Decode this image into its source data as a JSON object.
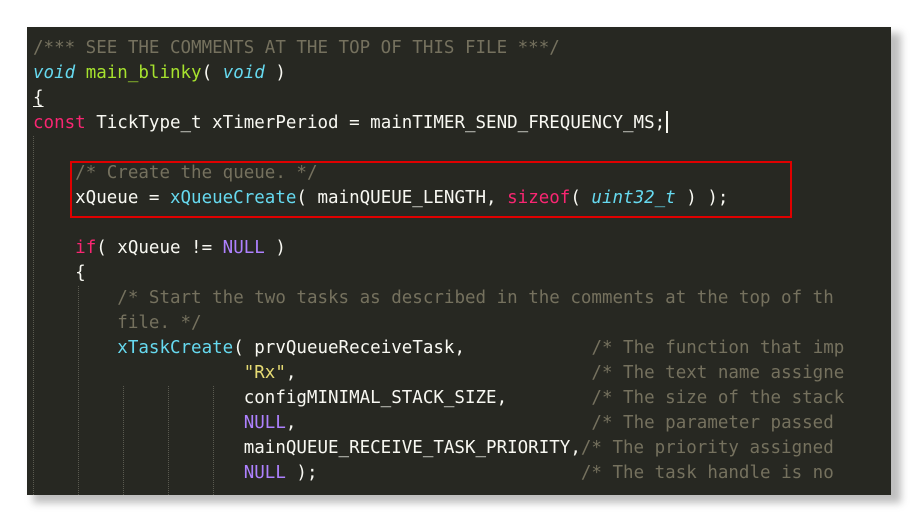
{
  "code_lines": [
    {
      "parts": [
        {
          "cls": "c",
          "text": "/*** SEE THE COMMENTS AT THE TOP OF THIS FILE ***/"
        }
      ]
    },
    {
      "parts": [
        {
          "cls": "t",
          "text": "void"
        },
        {
          "cls": "plain",
          "text": " "
        },
        {
          "cls": "f",
          "text": "main_blinky"
        },
        {
          "cls": "plain",
          "text": "( "
        },
        {
          "cls": "t",
          "text": "void"
        },
        {
          "cls": "plain",
          "text": " )"
        }
      ]
    },
    {
      "parts": [
        {
          "cls": "plain brace-ul",
          "text": "{"
        }
      ]
    },
    {
      "parts": [
        {
          "cls": "k",
          "text": "const"
        },
        {
          "cls": "plain",
          "text": " TickType_t xTimerPeriod = mainTIMER_SEND_FREQUENCY_MS;"
        }
      ],
      "cursor": true
    },
    {
      "parts": [
        {
          "cls": "plain",
          "text": ""
        }
      ]
    },
    {
      "parts": [
        {
          "cls": "plain",
          "text": "    "
        },
        {
          "cls": "c",
          "text": "/* Create the queue. */"
        }
      ]
    },
    {
      "parts": [
        {
          "cls": "plain",
          "text": "    xQueue = "
        },
        {
          "cls": "fc",
          "text": "xQueueCreate"
        },
        {
          "cls": "plain",
          "text": "( mainQUEUE_LENGTH, "
        },
        {
          "cls": "k",
          "text": "sizeof"
        },
        {
          "cls": "plain",
          "text": "( "
        },
        {
          "cls": "t",
          "text": "uint32_t"
        },
        {
          "cls": "plain",
          "text": " ) );"
        }
      ]
    },
    {
      "parts": [
        {
          "cls": "plain",
          "text": ""
        }
      ]
    },
    {
      "parts": [
        {
          "cls": "plain",
          "text": "    "
        },
        {
          "cls": "k",
          "text": "if"
        },
        {
          "cls": "plain",
          "text": "( xQueue != "
        },
        {
          "cls": "cn",
          "text": "NULL"
        },
        {
          "cls": "plain",
          "text": " )"
        }
      ]
    },
    {
      "parts": [
        {
          "cls": "plain",
          "text": "    {"
        }
      ]
    },
    {
      "parts": [
        {
          "cls": "plain",
          "text": "        "
        },
        {
          "cls": "c",
          "text": "/* Start the two tasks as described in the comments at the top of th"
        }
      ]
    },
    {
      "parts": [
        {
          "cls": "plain",
          "text": "        "
        },
        {
          "cls": "c",
          "text": "file. */"
        }
      ]
    },
    {
      "parts": [
        {
          "cls": "plain",
          "text": "        "
        },
        {
          "cls": "fc",
          "text": "xTaskCreate"
        },
        {
          "cls": "plain",
          "text": "( prvQueueReceiveTask,            "
        },
        {
          "cls": "c",
          "text": "/* The function that imp"
        }
      ]
    },
    {
      "parts": [
        {
          "cls": "plain",
          "text": "                    "
        },
        {
          "cls": "s",
          "text": "\"Rx\""
        },
        {
          "cls": "plain",
          "text": ",                            "
        },
        {
          "cls": "c",
          "text": "/* The text name assigne"
        }
      ]
    },
    {
      "parts": [
        {
          "cls": "plain",
          "text": "                    configMINIMAL_STACK_SIZE,        "
        },
        {
          "cls": "c",
          "text": "/* The size of the stack"
        }
      ]
    },
    {
      "parts": [
        {
          "cls": "plain",
          "text": "                    "
        },
        {
          "cls": "cn",
          "text": "NULL"
        },
        {
          "cls": "plain",
          "text": ",                            "
        },
        {
          "cls": "c",
          "text": "/* The parameter passed "
        }
      ]
    },
    {
      "parts": [
        {
          "cls": "plain",
          "text": "                    mainQUEUE_RECEIVE_TASK_PRIORITY,"
        },
        {
          "cls": "c",
          "text": "/* The priority assigned"
        }
      ]
    },
    {
      "parts": [
        {
          "cls": "plain",
          "text": "                    "
        },
        {
          "cls": "cn",
          "text": "NULL"
        },
        {
          "cls": "plain",
          "text": " );                         "
        },
        {
          "cls": "c",
          "text": "/* The task handle is no"
        }
      ]
    }
  ]
}
